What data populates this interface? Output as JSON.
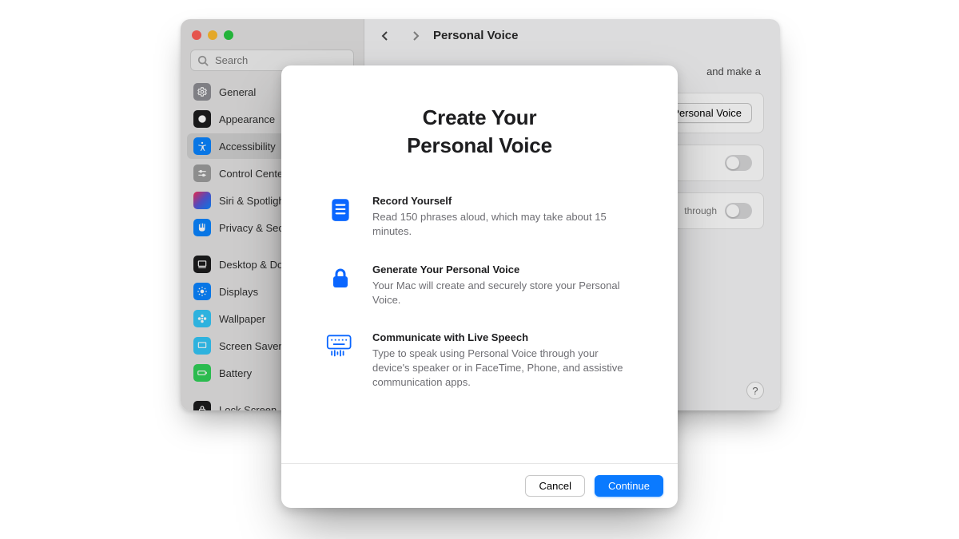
{
  "window": {
    "title": "Personal Voice",
    "search_placeholder": "Search"
  },
  "sidebar": {
    "items": [
      {
        "label": "General"
      },
      {
        "label": "Appearance"
      },
      {
        "label": "Accessibility"
      },
      {
        "label": "Control Center"
      },
      {
        "label": "Siri & Spotlight"
      },
      {
        "label": "Privacy & Security"
      },
      {
        "label": "Desktop & Dock"
      },
      {
        "label": "Displays"
      },
      {
        "label": "Wallpaper"
      },
      {
        "label": "Screen Saver"
      },
      {
        "label": "Battery"
      },
      {
        "label": "Lock Screen"
      }
    ]
  },
  "pane": {
    "description_tail": "and make a",
    "create_button": "Create a Personal Voice",
    "share_tail": "through",
    "help": "?"
  },
  "modal": {
    "title_line1": "Create Your",
    "title_line2": "Personal Voice",
    "features": [
      {
        "title": "Record Yourself",
        "desc": "Read 150 phrases aloud, which may take about 15 minutes."
      },
      {
        "title": "Generate Your Personal Voice",
        "desc": "Your Mac will create and securely store your Personal Voice."
      },
      {
        "title": "Communicate with Live Speech",
        "desc": "Type to speak using Personal Voice through your device's speaker or in FaceTime, Phone, and assistive communication apps."
      }
    ],
    "cancel": "Cancel",
    "continue": "Continue"
  }
}
